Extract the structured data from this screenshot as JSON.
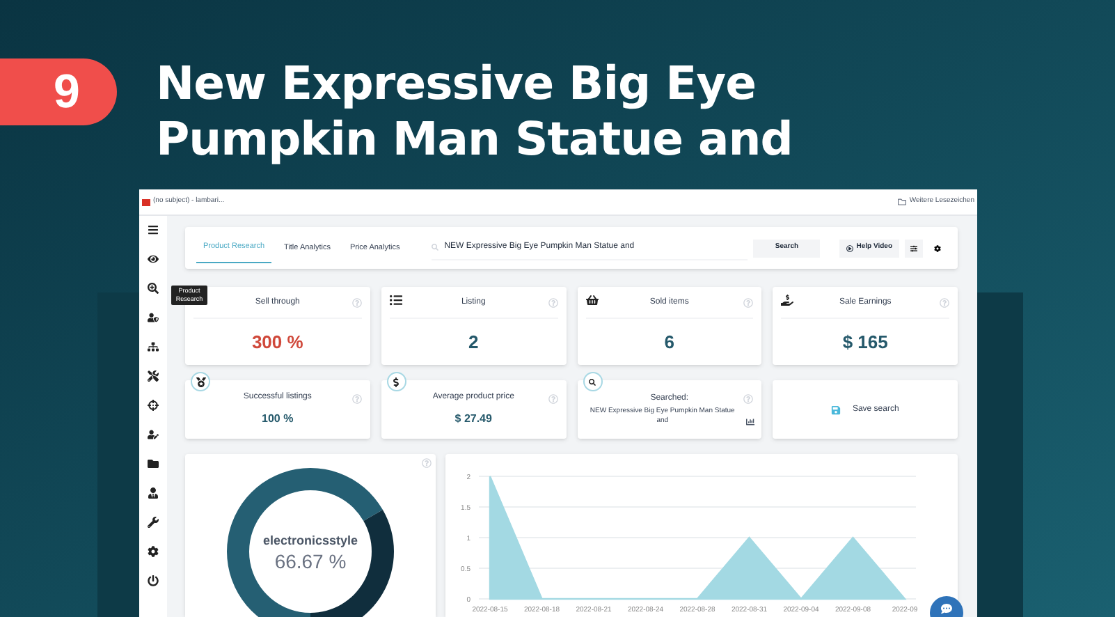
{
  "banner": {
    "number": "9",
    "title_lines": [
      "New Expressive Big Eye",
      "Pumpkin Man Statue and"
    ]
  },
  "browser": {
    "bookmark": "(no subject) - lambari...",
    "bookmarks_folder": "Weitere Lesezeichen"
  },
  "tooltip": "Product Research",
  "nav": {
    "tabs": [
      {
        "label": "Product Research",
        "selected": true
      },
      {
        "label": "Title Analytics",
        "selected": false
      },
      {
        "label": "Price Analytics",
        "selected": false
      }
    ],
    "search_value": "NEW Expressive Big Eye Pumpkin Man Statue and",
    "search_button": "Search",
    "help_button": "Help Video"
  },
  "stats": [
    {
      "title": "Sell through",
      "value": "300 %",
      "color": "#d0493b"
    },
    {
      "title": "Listing",
      "value": "2",
      "color": "#25596b"
    },
    {
      "title": "Sold items",
      "value": "6",
      "color": "#25596b"
    },
    {
      "title": "Sale Earnings",
      "value": "$ 165",
      "color": "#25596b"
    }
  ],
  "cards": [
    {
      "kind": "stat",
      "title": "Successful listings",
      "value": "100 %"
    },
    {
      "kind": "stat",
      "title": "Average product price",
      "value": "$ 27.49"
    },
    {
      "kind": "searched",
      "title": "Searched:",
      "value": "NEW Expressive Big Eye Pumpkin Man Statue and"
    },
    {
      "kind": "action",
      "title": "Save search"
    }
  ],
  "donut": {
    "label": "electronicsstyle",
    "value": "66.67 %",
    "chart_data": {
      "type": "donut",
      "values": [
        66.67,
        33.33
      ],
      "colors": [
        "#255f73",
        "#102e3d"
      ]
    }
  },
  "trend": {
    "chart_data": {
      "type": "area",
      "categories": [
        "2022-08-15",
        "2022-08-18",
        "2022-08-21",
        "2022-08-24",
        "2022-08-28",
        "2022-08-31",
        "2022-09-04",
        "2022-09-08",
        "2022-09"
      ],
      "series": [
        {
          "color": "#a3d9e3",
          "values": [
            2,
            0,
            0,
            0,
            0,
            1,
            0,
            1,
            0
          ]
        }
      ],
      "grid": true,
      "ylim": [
        0,
        2
      ],
      "yticks": [
        {
          "value": 0,
          "label": "0"
        },
        {
          "value": 0.5,
          "label": "0.5"
        },
        {
          "value": 1,
          "label": "1"
        },
        {
          "value": 1.5,
          "label": "1.5"
        },
        {
          "value": 2,
          "label": "2"
        }
      ]
    }
  }
}
